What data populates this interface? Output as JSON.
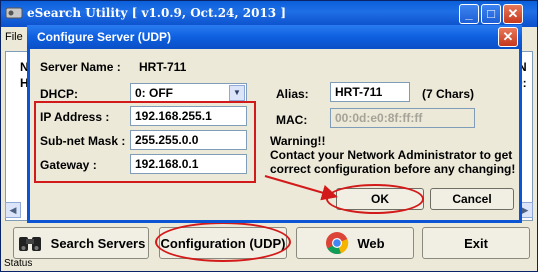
{
  "app": {
    "title": "eSearch Utility [ v1.0.9, Oct.24, 2013 ]",
    "menu": "File",
    "bg_left_letters": [
      "N",
      "H"
    ],
    "bg_right_letters": [
      "N",
      "0:"
    ],
    "status": "Status"
  },
  "bottom_buttons": {
    "search_servers": "Search Servers",
    "configuration": "Configuration (UDP)",
    "web": "Web",
    "exit": "Exit"
  },
  "dialog": {
    "title": "Configure Server (UDP)",
    "server_name_label": "Server Name :",
    "server_name_value": "HRT-711",
    "dhcp_label": "DHCP:",
    "dhcp_value": "0: OFF",
    "alias_label": "Alias:",
    "alias_value": "HRT-711",
    "alias_hint": "(7 Chars)",
    "mac_label": "MAC:",
    "mac_value": "00:0d:e0:8f:ff:ff",
    "ip_label": "IP Address :",
    "ip_value": "192.168.255.1",
    "mask_label": "Sub-net Mask :",
    "mask_value": "255.255.0.0",
    "gateway_label": "Gateway :",
    "gateway_value": "192.168.0.1",
    "warning_lines": [
      "Warning!!",
      "Contact your Network Administrator to get",
      "correct  configuration before any changing!"
    ],
    "ok_label": "OK",
    "cancel_label": "Cancel"
  },
  "colors": {
    "annotation_red": "#d31a1a",
    "titlebar_blue": "#0b55d4"
  }
}
